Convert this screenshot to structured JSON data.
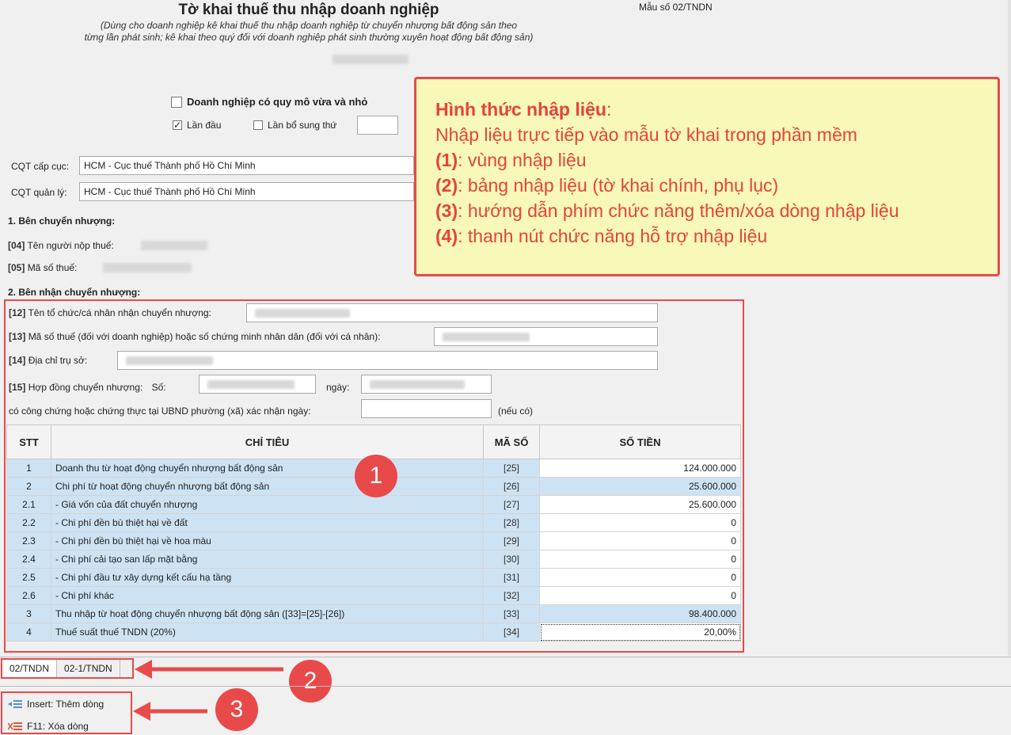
{
  "header": {
    "title": "Tờ khai thuế thu nhập doanh nghiệp",
    "subtitle_line1": "(Dùng cho doanh nghiệp kê khai thuế  thu nhập doanh nghiệp từ chuyển nhượng bất động sản theo",
    "subtitle_line2": "từng lần phát sinh; kê khai theo quý đối với doanh nghiệp phát sinh thường xuyên hoạt động bất động sản)",
    "form_number": "Mẫu số 02/TNDN"
  },
  "options": {
    "sme_label": "Doanh nghiệp có quy mô vừa và nhỏ",
    "sme_checked": false,
    "first_time_label": "Lần đầu",
    "first_time_checked": true,
    "supplement_label": "Lần bổ sung thứ",
    "supplement_checked": false,
    "supplement_value": ""
  },
  "tax_office": {
    "department_label": "CQT cấp cục:",
    "department_value": "HCM - Cục thuế Thành phố Hồ Chí Minh",
    "manager_label": "CQT quản lý:",
    "manager_value": "HCM - Cục thuế Thành phố Hồ Chí Minh"
  },
  "transferor": {
    "section_title": "1. Bên chuyển nhượng:",
    "name_code": "[04]",
    "name_label": "Tên người nộp thuế:",
    "tax_code_code": "[05]",
    "tax_code_label": "Mã số thuế:"
  },
  "transferee": {
    "section_title": "2. Bên nhận chuyển nhượng:",
    "f12_code": "[12]",
    "f12_label": "Tên tổ chức/cá nhân nhận chuyển nhượng:",
    "f13_code": "[13]",
    "f13_label": "Mã số thuế (đối với doanh nghiệp) hoặc số chứng minh nhân dân (đối với cá nhân):",
    "f14_code": "[14]",
    "f14_label": "Địa chỉ trụ sở:",
    "f15_code": "[15]",
    "f15_label": "Hợp đồng chuyển nhượng:",
    "so_label": "Số:",
    "ngay_label": "ngày:",
    "notary_label": "có công chứng hoặc chứng thực tại UBND phường (xã)  xác nhận ngày:",
    "notary_value": "",
    "optional_note": "(nếu có)"
  },
  "table": {
    "headers": [
      "STT",
      "CHỈ TIÊU",
      "MÃ SỐ",
      "SỐ TIỀN"
    ],
    "rows": [
      {
        "stt": "1",
        "label": "Doanh thu từ hoạt động chuyển nhượng bất động sản",
        "code": "[25]",
        "amount": "124.000.000",
        "shaded": false
      },
      {
        "stt": "2",
        "label": "Chi phí từ hoạt động chuyển nhượng bất động sản",
        "code": "[26]",
        "amount": "25.600.000",
        "shaded": true
      },
      {
        "stt": "2.1",
        "label": "- Giá vốn của đất chuyển nhượng",
        "code": "[27]",
        "amount": "25.600.000",
        "shaded": false
      },
      {
        "stt": "2.2",
        "label": "- Chi phí đền bù thiệt hại về đất",
        "code": "[28]",
        "amount": "0",
        "shaded": false
      },
      {
        "stt": "2.3",
        "label": "- Chi phí đền bù thiệt hại về hoa màu",
        "code": "[29]",
        "amount": "0",
        "shaded": false
      },
      {
        "stt": "2.4",
        "label": "- Chi phí cải tạo san lấp mặt bằng",
        "code": "[30]",
        "amount": "0",
        "shaded": false
      },
      {
        "stt": "2.5",
        "label": "- Chi phí đầu tư xây dựng kết cấu hạ tầng",
        "code": "[31]",
        "amount": "0",
        "shaded": false
      },
      {
        "stt": "2.6",
        "label": "- Chi phí khác",
        "code": "[32]",
        "amount": "0",
        "shaded": false
      },
      {
        "stt": "3",
        "label": "Thu nhập từ hoạt động chuyển nhượng bất động sản ([33]=[25]-[26])",
        "code": "[33]",
        "amount": "98.400.000",
        "shaded": true
      },
      {
        "stt": "4",
        "label": "Thuế suất thuế TNDN (20%)",
        "code": "[34]",
        "amount": "20,00%",
        "shaded": false
      }
    ]
  },
  "tabs": [
    "02/TNDN",
    "02-1/TNDN"
  ],
  "hints": {
    "insert": "Insert: Thêm dòng",
    "delete": "F11: Xóa dòng"
  },
  "callout": {
    "heading": "Hình thức nhập liệu",
    "line0": "Nhập liệu trực tiếp vào mẫu tờ khai trong phần mềm",
    "items": [
      {
        "num": "(1)",
        "text": ": vùng nhập liệu"
      },
      {
        "num": "(2)",
        "text": ": bảng nhập liệu (tờ khai chính, phụ lục)"
      },
      {
        "num": "(3)",
        "text": ": hướng dẫn phím chức năng thêm/xóa dòng nhập liệu"
      },
      {
        "num": "(4)",
        "text": ": thanh nút chức năng hỗ trợ nhập liệu"
      }
    ]
  },
  "badges": [
    "1",
    "2",
    "3"
  ],
  "colors": {
    "annotation_red": "#e84a4a",
    "callout_bg": "#f8f8b7",
    "row_highlight": "#cde3f4"
  }
}
